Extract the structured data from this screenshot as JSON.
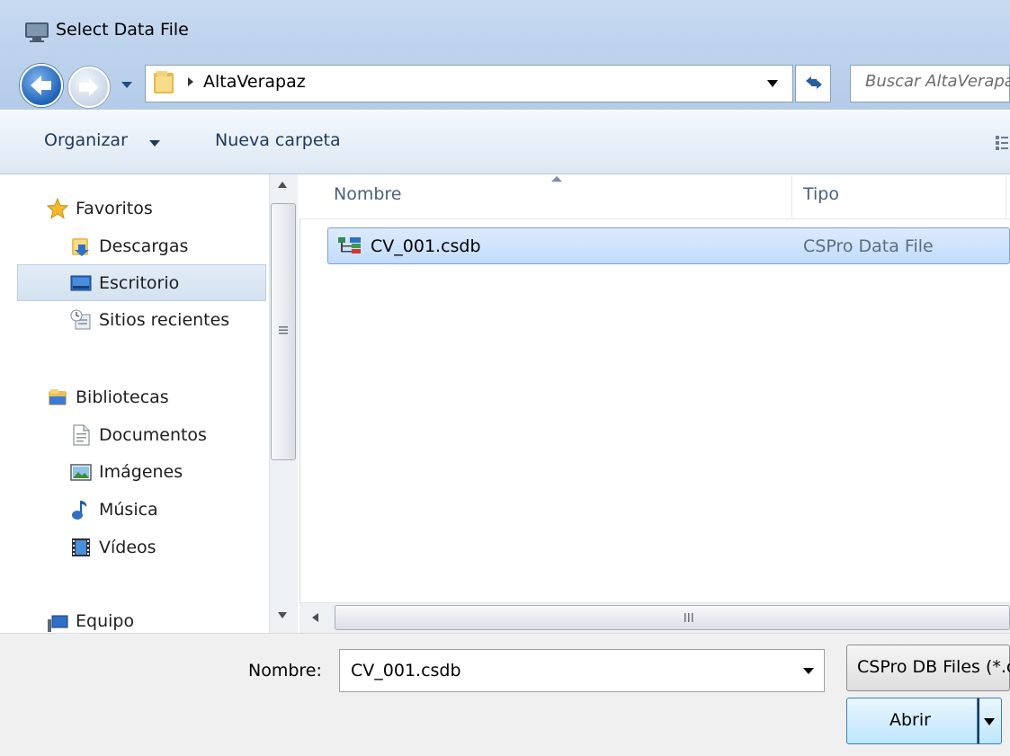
{
  "window": {
    "title": "Select Data File"
  },
  "address_bar": {
    "path": "AltaVerapaz",
    "search_placeholder": "Buscar AltaVerapaz"
  },
  "toolbar": {
    "organize_label": "Organizar",
    "new_folder_label": "Nueva carpeta"
  },
  "navigation": {
    "favorites": {
      "label": "Favoritos",
      "items": [
        {
          "label": "Descargas",
          "icon": "downloads-folder-icon"
        },
        {
          "label": "Escritorio",
          "icon": "desktop-icon",
          "selected": true
        },
        {
          "label": "Sitios recientes",
          "icon": "recent-places-icon"
        }
      ]
    },
    "libraries": {
      "label": "Bibliotecas",
      "items": [
        {
          "label": "Documentos",
          "icon": "documents-icon"
        },
        {
          "label": "Imágenes",
          "icon": "pictures-icon"
        },
        {
          "label": "Música",
          "icon": "music-icon"
        },
        {
          "label": "Vídeos",
          "icon": "videos-icon"
        }
      ]
    },
    "computer": {
      "label": "Equipo"
    }
  },
  "file_list": {
    "columns": [
      "Nombre",
      "Tipo"
    ],
    "rows": [
      {
        "name": "CV_001.csdb",
        "type": "CSPro Data File",
        "selected": true
      }
    ]
  },
  "footer": {
    "filename_label": "Nombre:",
    "filename_value": "CV_001.csdb",
    "filter_value": "CSPro DB Files (*.csdb)",
    "open_label": "Abrir"
  },
  "colors": {
    "titlebar": "#c4d8f0",
    "selection": "#cfe3fc",
    "selection_border": "#7da2ce",
    "primary_button": "#bee6fd"
  }
}
